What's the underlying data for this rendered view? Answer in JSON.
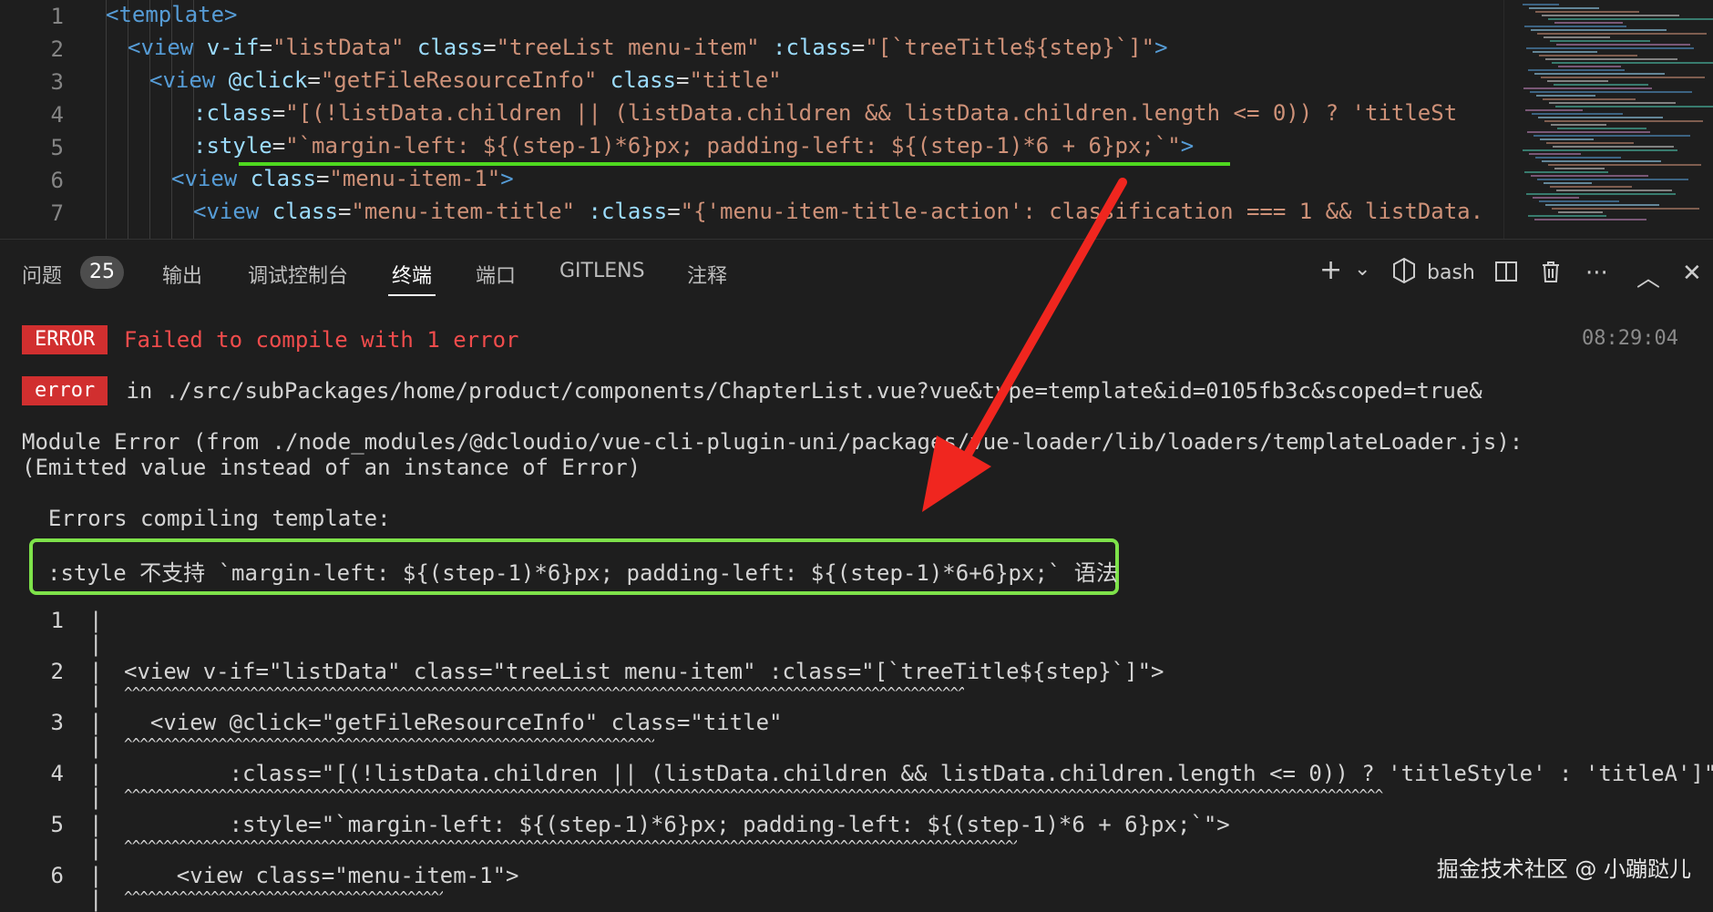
{
  "editor": {
    "line_numbers": [
      "1",
      "2",
      "3",
      "4",
      "5",
      "6",
      "7"
    ],
    "lines": [
      {
        "parts": [
          [
            "tag",
            "<template>"
          ]
        ]
      },
      {
        "parts": [
          [
            "tag",
            "<view "
          ],
          [
            "attr",
            "v-if"
          ],
          [
            "op",
            "="
          ],
          [
            "str",
            "\"listData\" "
          ],
          [
            "attr",
            "class"
          ],
          [
            "op",
            "="
          ],
          [
            "str",
            "\"treeList menu-item\" "
          ],
          [
            "attr",
            ":class"
          ],
          [
            "op",
            "="
          ],
          [
            "str",
            "\"[`treeTitle${step}`]\""
          ],
          [
            "tag",
            ">"
          ]
        ]
      },
      {
        "parts": [
          [
            "tag",
            "<view "
          ],
          [
            "attr",
            "@click"
          ],
          [
            "op",
            "="
          ],
          [
            "str",
            "\"getFileResourceInfo\" "
          ],
          [
            "attr",
            "class"
          ],
          [
            "op",
            "="
          ],
          [
            "str",
            "\"title\""
          ]
        ]
      },
      {
        "parts": [
          [
            "attr",
            ":class"
          ],
          [
            "op",
            "="
          ],
          [
            "str",
            "\"[(!listData.children || (listData.children && listData.children.length <= 0)) ? 'titleSt"
          ]
        ]
      },
      {
        "parts": [
          [
            "attr",
            ":style"
          ],
          [
            "op",
            "="
          ],
          [
            "str",
            "\"`margin-left: ${(step-1)*6}px; padding-left: ${(step-1)*6 + 6}px;`\""
          ],
          [
            "tag",
            ">"
          ]
        ]
      },
      {
        "parts": [
          [
            "tag",
            "<view "
          ],
          [
            "attr",
            "class"
          ],
          [
            "op",
            "="
          ],
          [
            "str",
            "\"menu-item-1\""
          ],
          [
            "tag",
            ">"
          ]
        ]
      },
      {
        "parts": [
          [
            "tag",
            "<view "
          ],
          [
            "attr",
            "class"
          ],
          [
            "op",
            "="
          ],
          [
            "str",
            "\"menu-item-title\" "
          ],
          [
            "attr",
            ":class"
          ],
          [
            "op",
            "="
          ],
          [
            "str",
            "\"{'menu-item-title-action': classification === 1 && listData."
          ]
        ]
      }
    ]
  },
  "panel_tabs": {
    "problems": "问题",
    "problems_count": "25",
    "output": "输出",
    "debug_console": "调试控制台",
    "terminal": "终端",
    "ports": "端口",
    "gitlens": "GITLENS",
    "comments": "注释"
  },
  "terminal_toolbar": {
    "new_terminal": "+",
    "dropdown": "⌄",
    "shell": "bash",
    "split": "◫",
    "trash": "🗑",
    "more": "···",
    "maximize": "︿",
    "close": "✕"
  },
  "terminal": {
    "error_badge": "ERROR",
    "error_msg": "Failed to compile with 1 error",
    "timestamp": "08:29:04",
    "error_badge_small": "error",
    "error_path": " in ./src/subPackages/home/product/components/ChapterList.vue?vue&type=template&id=0105fb3c&scoped=true&",
    "module_error": "Module Error (from ./node_modules/@dcloudio/vue-cli-plugin-uni/packages/vue-loader/lib/loaders/templateLoader.js):",
    "emitted": "(Emitted value instead of an instance of Error)",
    "errors_compiling": "  Errors compiling template:",
    "highlight_msg": ":style 不支持 `margin-left: ${(step-1)*6}px; padding-left: ${(step-1)*6+6}px;` 语法",
    "context": [
      {
        "num": "1",
        "text": ""
      },
      {
        "num": "2",
        "text": "<view v-if=\"listData\" class=\"treeList menu-item\" :class=\"[`treeTitle${step}`]\">"
      },
      {
        "num": "3",
        "text": "  <view @click=\"getFileResourceInfo\" class=\"title\""
      },
      {
        "num": "4",
        "text": "        :class=\"[(!listData.children || (listData.children && listData.children.length <= 0)) ? 'titleStyle' : 'titleA']\""
      },
      {
        "num": "5",
        "text": "        :style=\"`margin-left: ${(step-1)*6}px; padding-left: ${(step-1)*6 + 6}px;`\">"
      },
      {
        "num": "6",
        "text": "    <view class=\"menu-item-1\">"
      }
    ],
    "caret_char": "^"
  },
  "watermark": "掘金技术社区 @ 小蹦跶儿",
  "colors": {
    "arrow": "#f0261f",
    "highlight_green": "#7ee24a",
    "error_red": "#d12f2f"
  }
}
